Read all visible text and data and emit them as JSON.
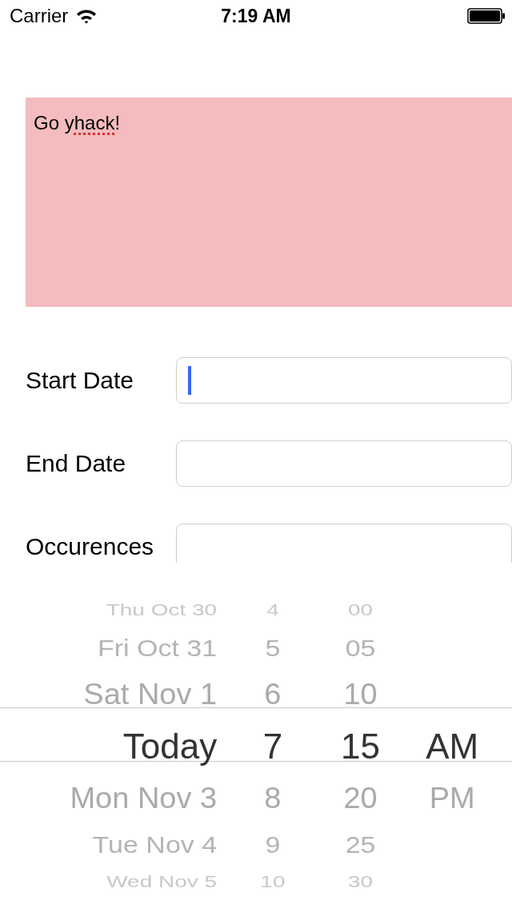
{
  "status_bar": {
    "carrier": "Carrier",
    "time": "7:19 AM"
  },
  "text_view": {
    "parts": [
      {
        "text": "Go ",
        "misspelled": false
      },
      {
        "text": "yhack",
        "misspelled": true
      },
      {
        "text": "!",
        "misspelled": false
      }
    ]
  },
  "fields": [
    {
      "label": "Start Date",
      "focused": true
    },
    {
      "label": "End Date",
      "focused": false
    },
    {
      "label": "Occurences",
      "focused": false
    }
  ],
  "picker": {
    "rows": [
      {
        "date": "Thu Oct 30",
        "hour": "4",
        "minute": "00",
        "selected": false
      },
      {
        "date": "Fri Oct 31",
        "hour": "5",
        "minute": "05",
        "selected": false
      },
      {
        "date": "Sat Nov 1",
        "hour": "6",
        "minute": "10",
        "selected": false
      },
      {
        "date": "Today",
        "hour": "7",
        "minute": "15",
        "period": "AM",
        "selected": true
      },
      {
        "date": "Mon Nov 3",
        "hour": "8",
        "minute": "20",
        "period": "PM",
        "selected": false
      },
      {
        "date": "Tue Nov 4",
        "hour": "9",
        "minute": "25",
        "selected": false
      },
      {
        "date": "Wed Nov 5",
        "hour": "10",
        "minute": "30",
        "selected": false
      }
    ]
  }
}
